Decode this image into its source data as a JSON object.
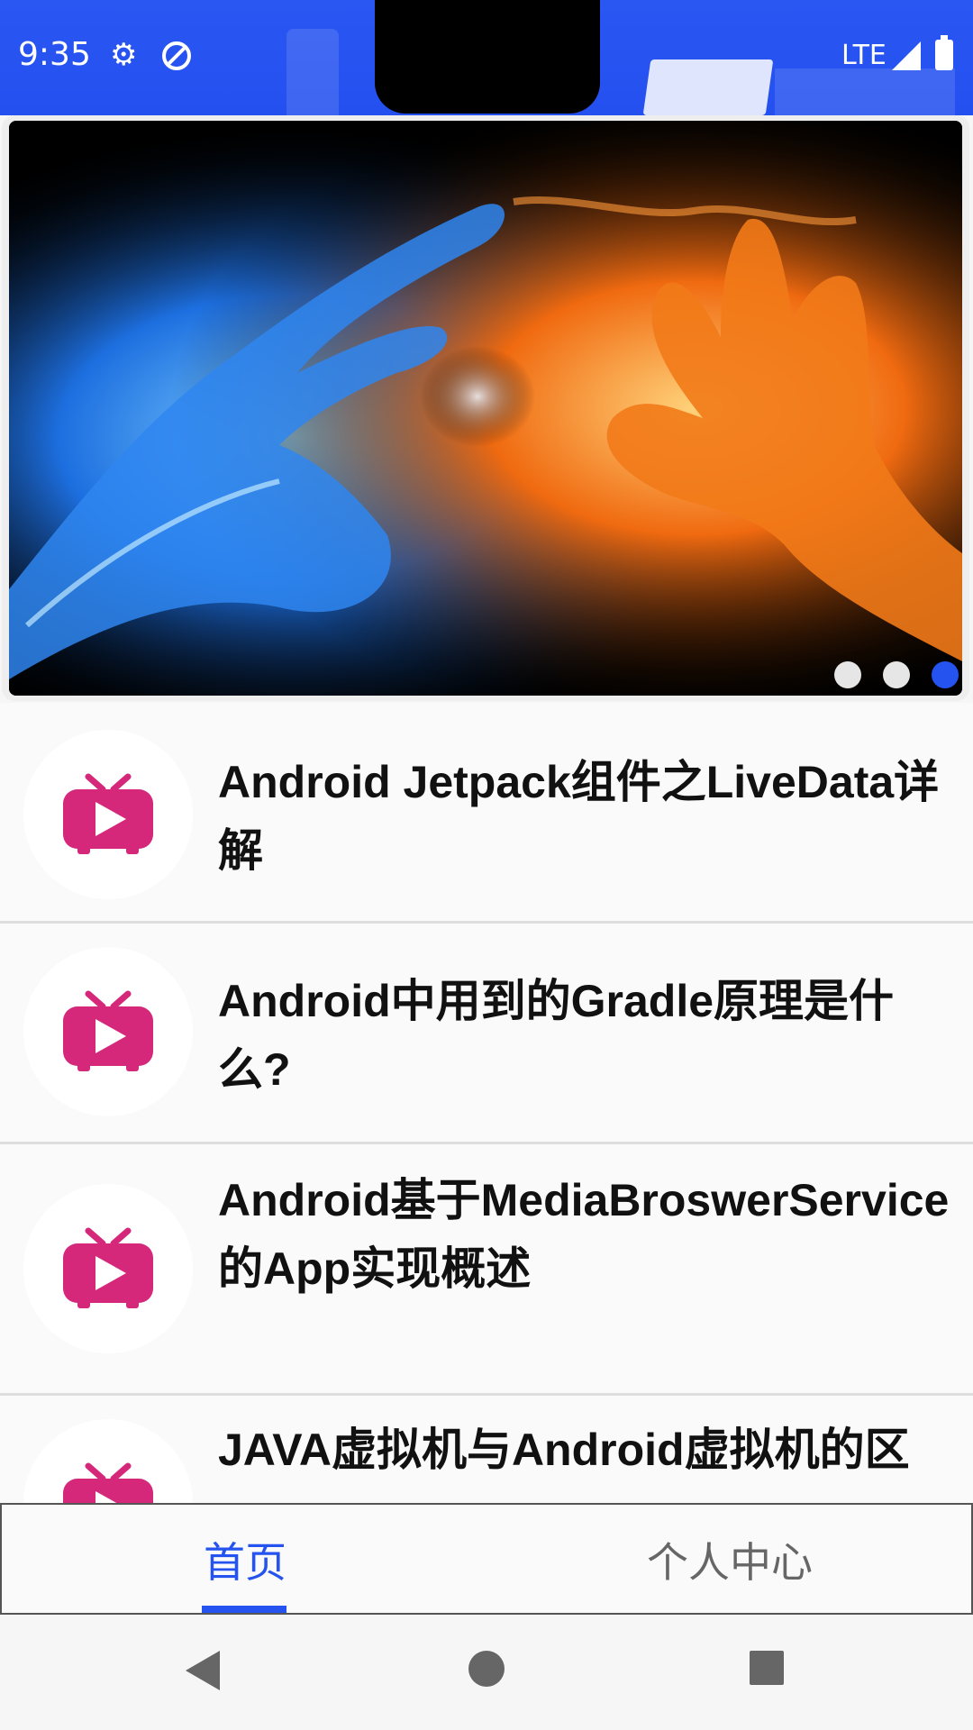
{
  "status_bar": {
    "time": "9:35",
    "network": "LTE",
    "icons": [
      "gear-icon",
      "data-saver-icon",
      "signal-icon",
      "battery-icon"
    ]
  },
  "banner": {
    "image_description_icon": "fire-ice-hands-image",
    "dots": 3,
    "active_index": 2
  },
  "articles": [
    {
      "title": "Android Jetpack组件之LiveData详解",
      "icon": "tv-play-icon"
    },
    {
      "title": "Android中用到的Gradle原理是什么?",
      "icon": "tv-play-icon"
    },
    {
      "title": "Android基于MediaBroswerService的App实现概述",
      "icon": "tv-play-icon"
    },
    {
      "title": "JAVA虚拟机与Android虚拟机的区",
      "icon": "tv-play-icon"
    }
  ],
  "tabs": {
    "home": "首页",
    "profile": "个人中心",
    "active": "home"
  },
  "colors": {
    "accent": "#2453ef",
    "icon_pink": "#d6287a",
    "status_bar": "#2450f0"
  }
}
